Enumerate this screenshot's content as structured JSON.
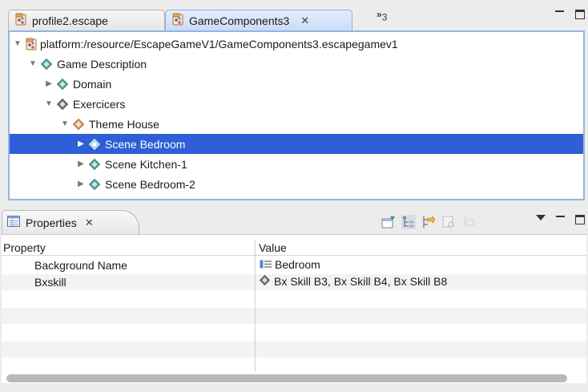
{
  "editor": {
    "tabs": [
      {
        "label": "profile2.escape",
        "active": false
      },
      {
        "label": "GameComponents3",
        "active": true,
        "close": "✕"
      }
    ],
    "overflow_count": "3",
    "tree": [
      {
        "label": "platform:/resource/EscapeGameV1/GameComponents3.escapegamev1",
        "icon": "model-file-icon",
        "expanded": true,
        "depth": 0
      },
      {
        "label": "Game Description",
        "icon": "element-icon",
        "expanded": true,
        "depth": 1
      },
      {
        "label": "Domain",
        "icon": "element-icon",
        "expanded": false,
        "depth": 2
      },
      {
        "label": "Exercicers",
        "icon": "element-icon",
        "expanded": true,
        "depth": 2
      },
      {
        "label": "Theme House",
        "icon": "element-icon",
        "expanded": true,
        "depth": 3
      },
      {
        "label": "Scene Bedroom",
        "icon": "element-icon",
        "expanded": false,
        "depth": 4,
        "selected": true
      },
      {
        "label": "Scene Kitchen-1",
        "icon": "element-icon",
        "expanded": false,
        "depth": 4
      },
      {
        "label": "Scene Bedroom-2",
        "icon": "element-icon",
        "expanded": false,
        "depth": 4
      }
    ]
  },
  "properties": {
    "tab_label": "Properties",
    "tab_close": "✕",
    "columns": {
      "property": "Property",
      "value": "Value"
    },
    "rows": [
      {
        "property": "Background Name",
        "value": "Bedroom",
        "icon": "text-value-icon"
      },
      {
        "property": "Bxskill",
        "value": "Bx Skill B3, Bx Skill B4, Bx Skill B8",
        "icon": "element-icon"
      }
    ]
  },
  "colors": {
    "selection": "#2f5fd6",
    "active_tab": "#cadcf5",
    "tree_border": "#93b5e2"
  }
}
